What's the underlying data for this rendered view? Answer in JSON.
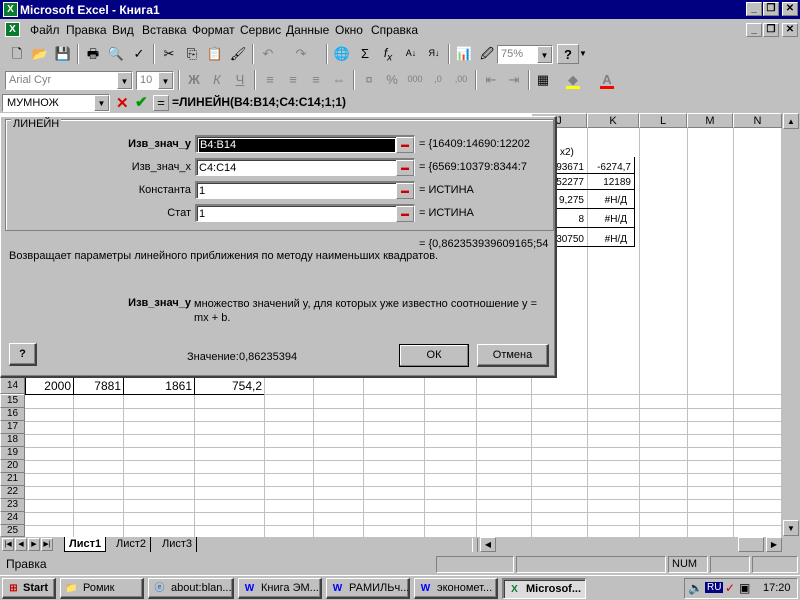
{
  "window": {
    "title": "Microsoft Excel - Книга1",
    "app_icon": "excel-icon",
    "controls": [
      "_",
      "❐",
      "✕"
    ]
  },
  "menu": {
    "items": [
      "Файл",
      "Правка",
      "Вид",
      "Вставка",
      "Формат",
      "Сервис",
      "Данные",
      "Окно",
      "Справка"
    ]
  },
  "toolbar": {
    "zoom": "75%",
    "font_name": "Arial Cyr",
    "font_size": "10"
  },
  "formula_bar": {
    "name_box": "МУМНОЖ",
    "formula": "=ЛИНЕЙН(B4:B14;C4:C14;1;1)"
  },
  "grid": {
    "columns": [
      "J",
      "K",
      "L",
      "M",
      "N"
    ],
    "rows": [
      "14",
      "15",
      "16",
      "17",
      "18",
      "19",
      "20",
      "21",
      "22",
      "23",
      "24",
      "25"
    ],
    "row14_values": [
      "2000",
      "7881",
      "1861",
      "754,2"
    ],
    "visible_fragment": {
      "header": "x2)",
      "j_values": [
        "93671",
        "52277",
        "9,275",
        "8",
        "30750"
      ],
      "k_values": [
        "-6274,7",
        "12189",
        "#Н/Д",
        "#Н/Д",
        "#Н/Д"
      ]
    }
  },
  "dialog": {
    "title": "ЛИНЕЙН",
    "fields": [
      {
        "label": "Изв_знач_y",
        "value": "B4:B14",
        "result": "= {16409:14690:12202",
        "bold": true
      },
      {
        "label": "Изв_знач_x",
        "value": "C4:C14",
        "result": "= {6569:10379:8344:7",
        "bold": false
      },
      {
        "label": "Константа",
        "value": "1",
        "result": "= ИСТИНА",
        "bold": false
      },
      {
        "label": "Стат",
        "value": "1",
        "result": "= ИСТИНА",
        "bold": false
      }
    ],
    "formula_result": "= {0,862353939609165;54",
    "description": "Возвращает параметры линейного приближения по методу наименьших квадратов.",
    "arg_name": "Изв_знач_y",
    "arg_description": "множество значений y, для которых уже известно соотношение y = mx + b.",
    "value_label": "Значение:",
    "value": "0,86235394",
    "ok_label": "ОК",
    "cancel_label": "Отмена",
    "help_icon": "help-icon"
  },
  "sheets": {
    "tabs": [
      "Лист1",
      "Лист2",
      "Лист3"
    ],
    "active": "Лист1"
  },
  "status": {
    "mode": "Правка",
    "indicator": "NUM"
  },
  "taskbar": {
    "start": "Start",
    "tasks": [
      "Ромик",
      "about:blan...",
      "Книга ЭМ...",
      "РАМИЛЬч...",
      "экономет...",
      "Microsof..."
    ],
    "lang": "RU",
    "time": "17:20"
  }
}
